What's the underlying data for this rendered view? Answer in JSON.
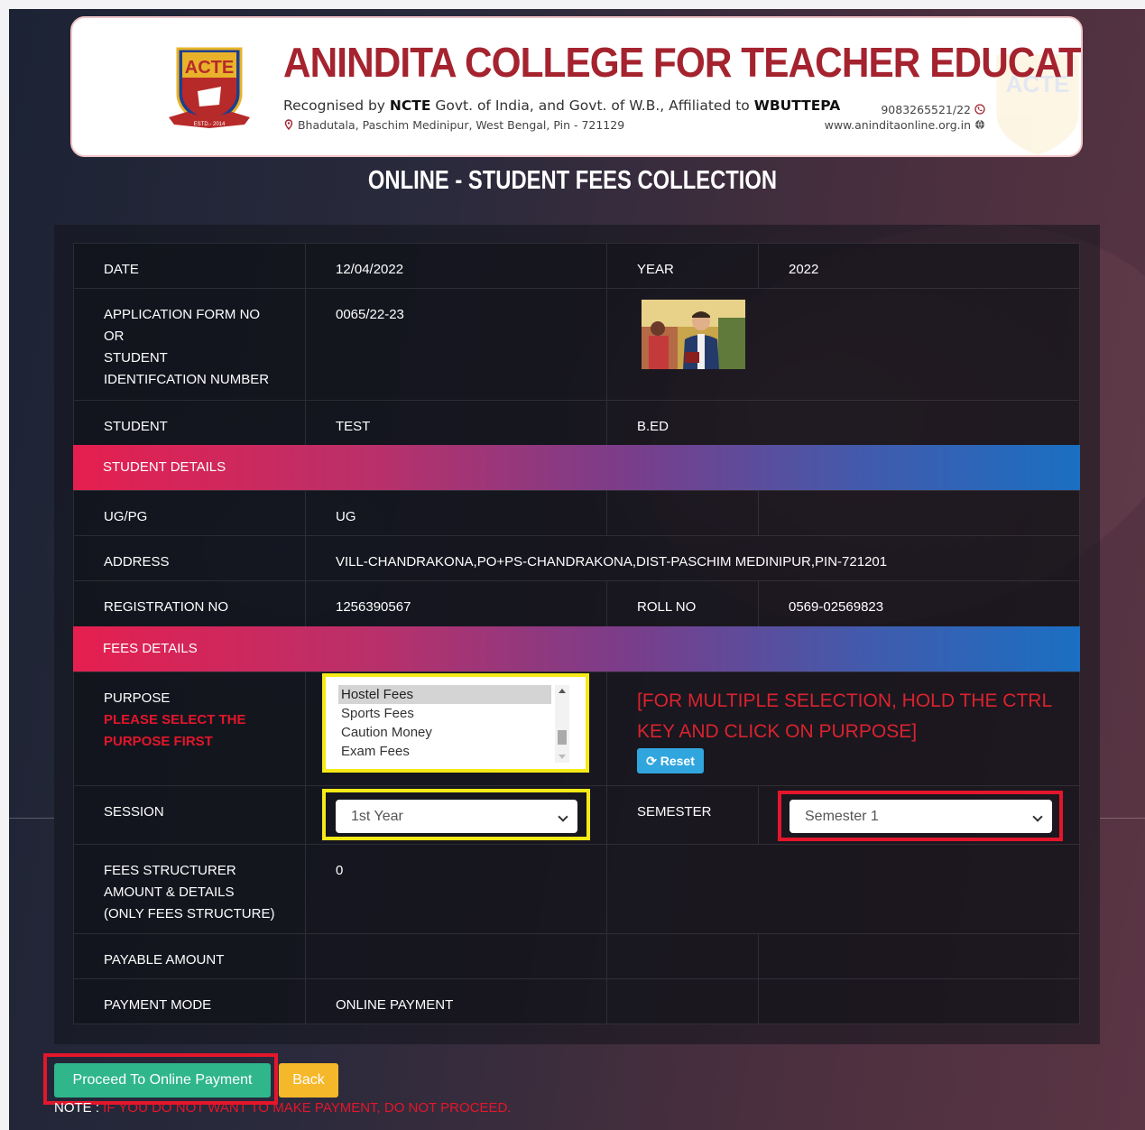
{
  "header": {
    "college_name": "ANINDITA COLLEGE FOR TEACHER EDUCATION",
    "recog_prefix": "Recognised by ",
    "recog_ncte": "NCTE",
    "recog_mid": " Govt. of India, and Govt. of W.B., Affiliated to ",
    "recog_wbuttepa": "WBUTTEPA",
    "address": "Bhadutala, Paschim Medinipur, West Bengal, Pin - 721129",
    "phone": "9083265521/22",
    "website": "www.aninditaonline.org.in",
    "logo_text": "ACTE",
    "logo_estd": "ESTD.- 2014"
  },
  "page_title": "ONLINE - STUDENT FEES COLLECTION",
  "rows": {
    "date_label": "DATE",
    "date_value": "12/04/2022",
    "year_label": "YEAR",
    "year_value": "2022",
    "appno_label_1": "APPLICATION FORM NO",
    "appno_label_2": "OR",
    "appno_label_3": "STUDENT",
    "appno_label_4": "IDENTIFCATION NUMBER",
    "appno_value": "0065/22-23",
    "student_label": "STUDENT",
    "student_value": "TEST",
    "course_value": "B.ED",
    "student_details_section": "STUDENT DETAILS",
    "ugpg_label": "UG/PG",
    "ugpg_value": "UG",
    "address_label": "ADDRESS",
    "address_value": "VILL-CHANDRAKONA,PO+PS-CHANDRAKONA,DIST-PASCHIM MEDINIPUR,PIN-721201",
    "reg_label": "REGISTRATION NO",
    "reg_value": "1256390567",
    "roll_label": "ROLL NO",
    "roll_value": "0569-02569823",
    "fees_details_section": "FEES DETAILS",
    "purpose_label": "PURPOSE",
    "purpose_warning_1": "PLEASE SELECT THE",
    "purpose_warning_2": "PURPOSE FIRST",
    "purpose_options": [
      "Hostel Fees",
      "Sports Fees",
      "Caution Money",
      "Exam Fees"
    ],
    "purpose_hint": "[FOR MULTIPLE SELECTION, HOLD THE CTRL KEY AND CLICK ON PURPOSE]",
    "reset_label": "Reset",
    "session_label": "SESSION",
    "session_value": "1st Year",
    "semester_label": "SEMESTER",
    "semester_value": "Semester 1",
    "fees_struct_label_1": "FEES STRUCTURER",
    "fees_struct_label_2": "AMOUNT & DETAILS",
    "fees_struct_label_3": "(ONLY FEES STRUCTURE)",
    "fees_struct_value": "0",
    "payable_label": "PAYABLE AMOUNT",
    "payment_mode_label": "PAYMENT MODE",
    "payment_mode_value": "ONLINE PAYMENT"
  },
  "actions": {
    "proceed_label": "Proceed To Online Payment",
    "back_label": "Back",
    "note_prefix": "NOTE : ",
    "note_text": "IF YOU DO NOT WANT TO MAKE PAYMENT, DO NOT PROCEED."
  },
  "colors": {
    "college_red": "#a4232f",
    "section_start": "#e51f4f",
    "section_end": "#1a6fc2",
    "highlight_yellow": "#f5ea16",
    "highlight_red": "#e3162b",
    "proceed_green": "#2fb68a",
    "back_yellow": "#f5b82a",
    "reset_blue": "#31a6de"
  }
}
